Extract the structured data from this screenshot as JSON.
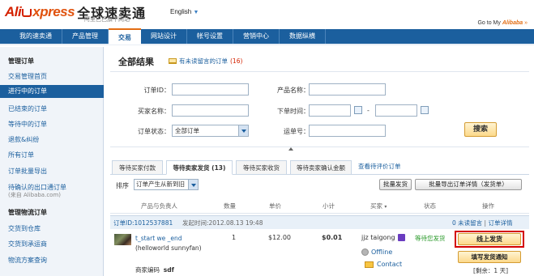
{
  "header": {
    "logo_en_prefix": "Ali",
    "logo_en_main": "xpress",
    "logo_cn": "全球速卖通",
    "logo_sub": "阿里巴巴旗下网站",
    "language": "English",
    "goto_prefix": "Go to My",
    "goto_brand": "Alibaba",
    "goto_suffix": "»"
  },
  "nav": {
    "items": [
      {
        "label": "我的速卖通"
      },
      {
        "label": "产品管理"
      },
      {
        "label": "交易"
      },
      {
        "label": "网站设计"
      },
      {
        "label": "帐号设置"
      },
      {
        "label": "营销中心"
      },
      {
        "label": "数据纵横"
      }
    ],
    "active_index": 2
  },
  "sidebar": {
    "section1": "管理订单",
    "items1": [
      {
        "label": "交易管理首页"
      },
      {
        "label": "进行中的订单"
      },
      {
        "label": "已结束的订单"
      },
      {
        "label": "等待中的订单"
      },
      {
        "label": "退款&纠纷"
      },
      {
        "label": "所有订单"
      },
      {
        "label": "订单批量导出"
      },
      {
        "label": "待确认的出口通订单"
      }
    ],
    "items1_sub": "(来自 Alibaba.com)",
    "section2": "管理物流订单",
    "items2": [
      {
        "label": "交货到仓库"
      },
      {
        "label": "交货到承运商"
      },
      {
        "label": "物流方案查询"
      }
    ]
  },
  "main": {
    "title": "全部结果",
    "unread_text": "有未读留言的订单",
    "unread_count": "(16)"
  },
  "search": {
    "order_id_label": "订单ID：",
    "product_name_label": "产品名称：",
    "buyer_name_label": "买家名称：",
    "order_time_label": "下单时间：",
    "time_separator": "-",
    "order_status_label": "订单状态：",
    "order_status_value": "全部订单",
    "waybill_label": "运单号：",
    "search_button": "搜索"
  },
  "tabs": [
    {
      "label": "等待买家付款"
    },
    {
      "label": "等待卖家发货 (13)"
    },
    {
      "label": "等待买家收货"
    },
    {
      "label": "等待卖家确认金额"
    }
  ],
  "tab_link": "查看待评价订单",
  "sort": {
    "label": "排序",
    "value": "订单产生从新到旧"
  },
  "actions": {
    "bulk_ship": "批量发货",
    "bulk_export": "批量导出订单详情（发货单）"
  },
  "table": {
    "headers": [
      "产品与负责人",
      "数量",
      "单价",
      "小计",
      "买家",
      "状态",
      "操作"
    ],
    "buyer_sort_caret": "▾"
  },
  "order": {
    "id_text": "订单ID:1012537881",
    "time_text": "发起时间:2012.08.13 19:48",
    "unread_messages": "0 未读留言",
    "separator": "|",
    "detail_link": "订单详情",
    "product_link": "t_start we _end",
    "product_text": "(helloworld sunnyfan)",
    "code_label": "商家编码",
    "code_value": "sdf",
    "quantity": "1",
    "price": "$12.00",
    "subtotal": "$0.01",
    "buyer_name": "jjz taigong",
    "buyer_status": "Offline",
    "contact": "Contact",
    "status": "等待您发货",
    "ship_button": "线上发货",
    "notify_button": "填写发货通知",
    "remaining": "[剩余：1 天]"
  }
}
